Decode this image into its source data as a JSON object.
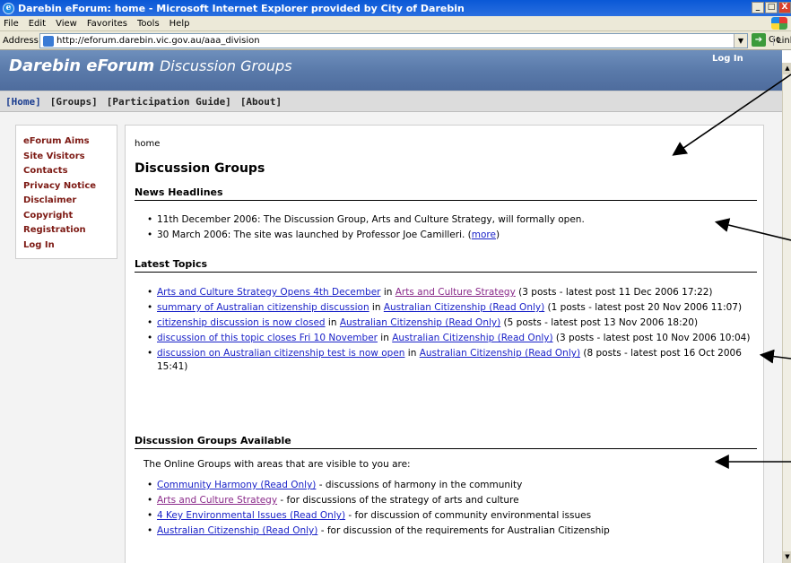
{
  "window": {
    "title": "Darebin eForum: home - Microsoft Internet Explorer provided by City of Darebin",
    "icon": "ie-icon",
    "controls": [
      "_",
      "□",
      "X"
    ]
  },
  "menu": [
    "File",
    "Edit",
    "View",
    "Favorites",
    "Tools",
    "Help"
  ],
  "address": {
    "label": "Address",
    "url": "http://eforum.darebin.vic.gov.au/aaa_division",
    "go_label": "Go",
    "links_label": "Links"
  },
  "site": {
    "title_bold": "Darebin eForum",
    "title_sub": "Discussion Groups",
    "login": "Log In",
    "nav": [
      "[Home]",
      "[Groups]",
      "[Participation Guide]",
      "[About]"
    ]
  },
  "leftnav": [
    "eForum Aims",
    "Site Visitors",
    "Contacts",
    "Privacy Notice",
    "Disclaimer",
    "Copyright",
    "Registration",
    "Log In"
  ],
  "main": {
    "breadcrumb": "home",
    "heading": "Discussion Groups",
    "news_heading": "News Headlines",
    "news": [
      {
        "text": "11th December 2006: The Discussion Group, Arts and Culture Strategy, will formally open."
      },
      {
        "text": "30 March 2006: The site was launched by Professor Joe Camilleri. (",
        "link": "more",
        "tail": ")"
      }
    ],
    "topics_heading": "Latest Topics",
    "topics": [
      {
        "topic": "Arts and Culture Strategy Opens 4th December",
        "in": " in ",
        "group": "Arts and Culture Strategy",
        "group_visited": true,
        "info": " (3 posts - latest post 11 Dec 2006 17:22)"
      },
      {
        "topic": "summary of Australian citizenship discussion",
        "in": " in ",
        "group": "Australian Citizenship (Read Only)",
        "group_visited": false,
        "info": " (1 posts - latest post 20 Nov 2006 11:07)"
      },
      {
        "topic": "citizenship discussion is now closed",
        "in": " in ",
        "group": "Australian Citizenship (Read Only)",
        "group_visited": false,
        "info": " (5 posts - latest post 13 Nov 2006 18:20)"
      },
      {
        "topic": "discussion of this topic closes Fri 10 November",
        "in": " in ",
        "group": "Australian Citizenship (Read Only)",
        "group_visited": false,
        "info": " (3 posts - latest post 10 Nov 2006 10:04)"
      },
      {
        "topic": "discussion on Australian citizenship test is now open",
        "in": " in ",
        "group": "Australian Citizenship (Read Only)",
        "group_visited": false,
        "info": " (8 posts - latest post 16 Oct 2006 15:41)"
      }
    ],
    "groups_heading": "Discussion Groups Available",
    "groups_intro": "The Online Groups with areas that are visible to you are:",
    "groups": [
      {
        "name": "Community Harmony (Read Only)",
        "visited": false,
        "desc": " - discussions of harmony in the community"
      },
      {
        "name": "Arts and Culture Strategy",
        "visited": true,
        "desc": " - for discussions of the strategy of arts and culture"
      },
      {
        "name": "4 Key Environmental Issues (Read Only)",
        "visited": false,
        "desc": " - for discussion of community environmental issues"
      },
      {
        "name": "Australian Citizenship (Read Only)",
        "visited": false,
        "desc": " - for discussion of the requirements for Australian Citizenship"
      }
    ]
  },
  "colors": {
    "header": "#5a7aaa",
    "link": "#1a22c8",
    "visited": "#8a2a8a",
    "leftnav": "#7d1a14"
  }
}
